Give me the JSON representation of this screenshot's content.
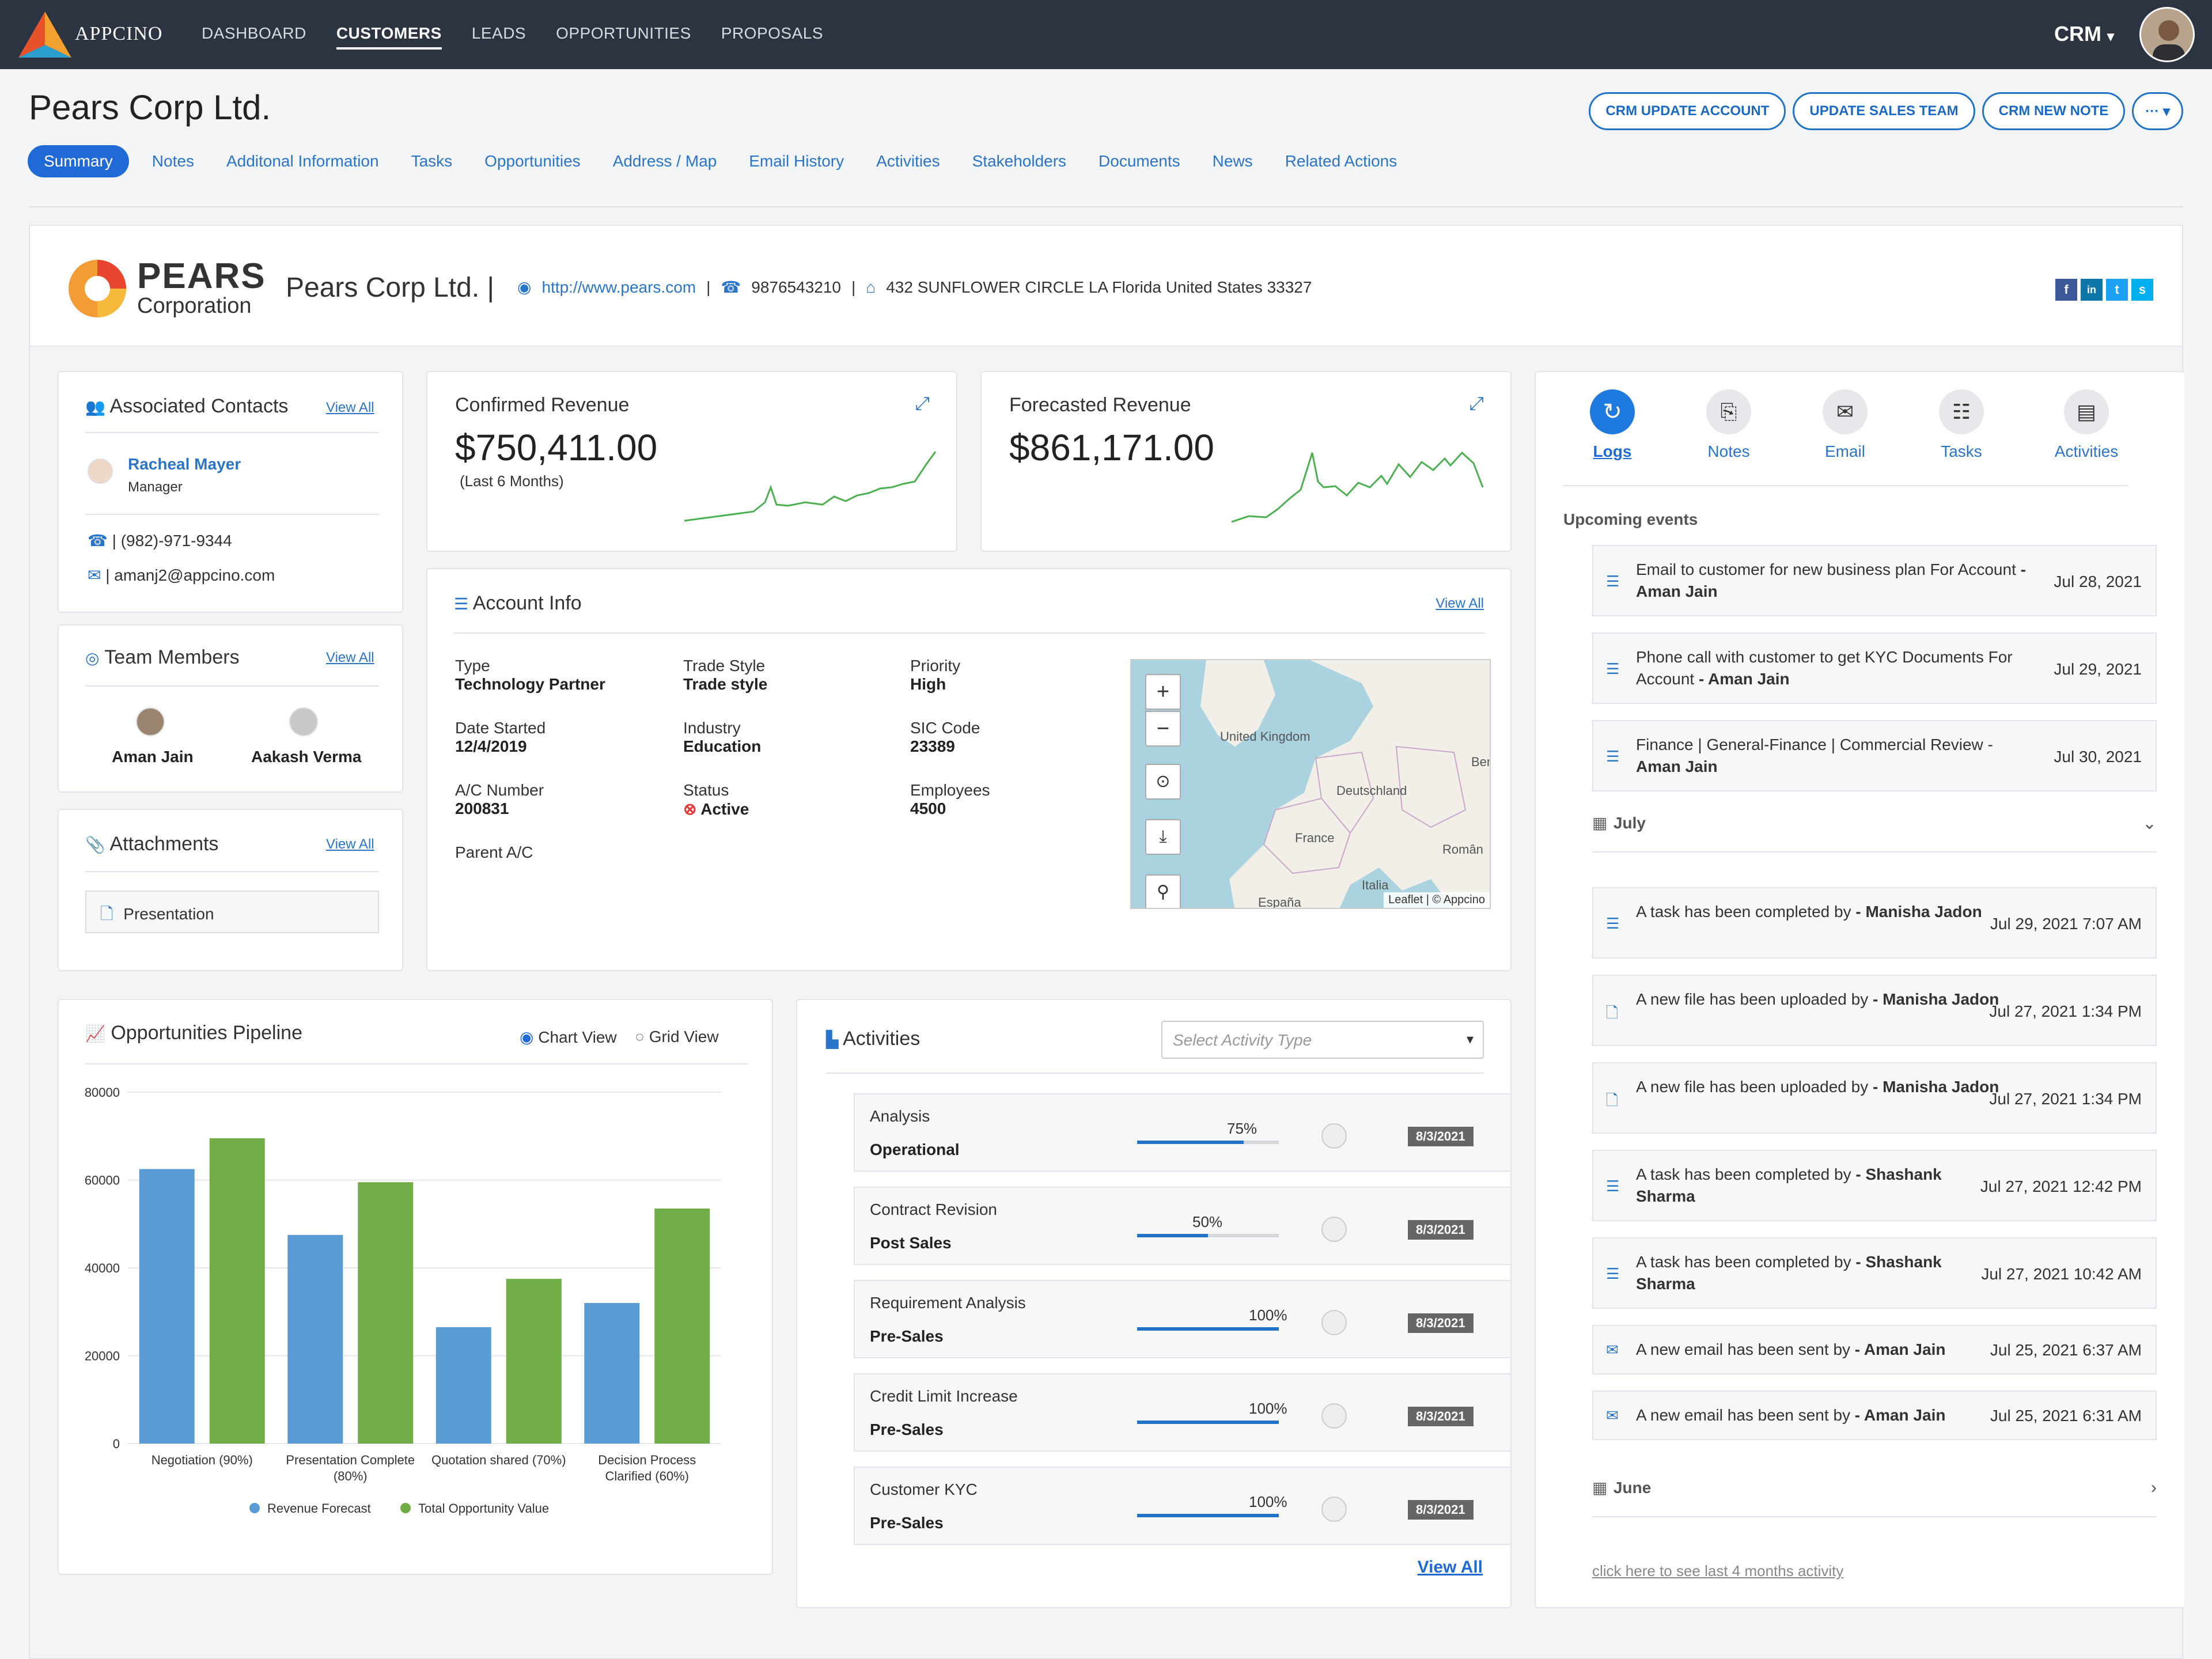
{
  "app": {
    "name": "APPCINO"
  },
  "nav": [
    "DASHBOARD",
    "CUSTOMERS",
    "LEADS",
    "OPPORTUNITIES",
    "PROPOSALS"
  ],
  "crm_menu": "CRM",
  "page_title": "Pears Corp Ltd.",
  "actions": [
    "CRM UPDATE ACCOUNT",
    "UPDATE SALES TEAM",
    "CRM NEW NOTE"
  ],
  "tabs": [
    "Summary",
    "Notes",
    "Additonal Information",
    "Tasks",
    "Opportunities",
    "Address / Map",
    "Email History",
    "Activities",
    "Stakeholders",
    "Documents",
    "News",
    "Related Actions"
  ],
  "company": {
    "logo_word": "PEARS",
    "logo_sub": "Corporation",
    "name": "Pears Corp Ltd.",
    "website": "http://www.pears.com",
    "phone": "9876543210",
    "address": "432 SUNFLOWER CIRCLE LA Florida United States 33327",
    "socials": [
      "f",
      "in",
      "t",
      "s"
    ]
  },
  "associated_contacts": {
    "title": "Associated Contacts",
    "view_all": "View All",
    "contact_name": "Racheal Mayer",
    "contact_role": "Manager",
    "phone": "| (982)-971-9344",
    "email": "| amanj2@appcino.com"
  },
  "team_members": {
    "title": "Team Members",
    "view_all": "View All",
    "members": [
      "Aman Jain",
      "Aakash Verma"
    ]
  },
  "attachments": {
    "title": "Attachments",
    "view_all": "View All",
    "file": "Presentation"
  },
  "confirmed_revenue": {
    "title": "Confirmed Revenue",
    "value": "$750,411.00",
    "note": "(Last 6 Months)"
  },
  "forecasted_revenue": {
    "title": "Forecasted Revenue",
    "value": "$861,171.00"
  },
  "account_info": {
    "title": "Account Info",
    "view_all": "View All",
    "fields": [
      {
        "label": "Type",
        "value": "Technology Partner"
      },
      {
        "label": "Trade Style",
        "value": "Trade style"
      },
      {
        "label": "Priority",
        "value": "High"
      },
      {
        "label": "Date Started",
        "value": "12/4/2019"
      },
      {
        "label": "Industry",
        "value": "Education"
      },
      {
        "label": "SIC Code",
        "value": "23389"
      },
      {
        "label": "A/C Number",
        "value": "200831"
      },
      {
        "label": "Status",
        "value": "Active"
      },
      {
        "label": "Employees",
        "value": "4500"
      },
      {
        "label": "Parent A/C",
        "value": ""
      }
    ],
    "map_labels": [
      "United Kingdom",
      "Deutschland",
      "France",
      "Ben",
      "Român",
      "Italia",
      "España"
    ],
    "map_attrib": "Leaflet | © Appcino"
  },
  "log_tabs": [
    "Logs",
    "Notes",
    "Email",
    "Tasks",
    "Activities"
  ],
  "upcoming": {
    "title": "Upcoming events",
    "items": [
      {
        "text": "Email to customer for new business plan For Account",
        "who": "- Aman Jain",
        "date": "Jul 28, 2021"
      },
      {
        "text": "Phone call with customer to get KYC Documents For Account",
        "who": "- Aman Jain",
        "date": "Jul 29, 2021"
      },
      {
        "text": "Finance  | General-Finance | Commercial Review -",
        "who": "Aman Jain",
        "date": "Jul 30, 2021"
      }
    ]
  },
  "month_july": "July",
  "month_june": "June",
  "history": [
    {
      "text": "A task has been completed by",
      "who": "- Manisha Jadon",
      "date": "Jul 29, 2021 7:07 AM",
      "icon": "list-icon"
    },
    {
      "text": "A new file has been uploaded by",
      "who": "- Manisha Jadon",
      "date": "Jul 27, 2021 1:34 PM",
      "icon": "file-icon"
    },
    {
      "text": "A new file has been uploaded by",
      "who": "- Manisha Jadon",
      "date": "Jul 27, 2021 1:34 PM",
      "icon": "file-icon"
    },
    {
      "text": "A task has been completed by",
      "who": "- Shashank Sharma",
      "date": "Jul 27, 2021 12:42 PM",
      "icon": "list-icon"
    },
    {
      "text": "A task has been completed by",
      "who": "- Shashank Sharma",
      "date": "Jul 27, 2021 10:42 AM",
      "icon": "list-icon"
    },
    {
      "text": "A new email has been sent by",
      "who": "- Aman Jain",
      "date": "Jul 25, 2021 6:37 AM",
      "icon": "mail-icon"
    },
    {
      "text": "A new email has been sent by",
      "who": "- Aman Jain",
      "date": "Jul 25, 2021 6:31 AM",
      "icon": "mail-icon"
    }
  ],
  "last_months_link": "click here to see last 4 months activity",
  "pipeline": {
    "title": "Opportunities Pipeline",
    "views": [
      "Chart View",
      "Grid View"
    ]
  },
  "chart_data": {
    "type": "bar",
    "categories": [
      "Negotiation (90%)",
      "Presentation Complete (80%)",
      "Quotation shared (70%)",
      "Decision Process Clarified (60%)"
    ],
    "series": [
      {
        "name": "Revenue Forecast",
        "values": [
          62500,
          47500,
          26500,
          32000
        ],
        "color": "#5b9bd5"
      },
      {
        "name": "Total Opportunity Value",
        "values": [
          69500,
          59500,
          37500,
          53500
        ],
        "color": "#70ad47"
      }
    ],
    "ylim": [
      0,
      80000
    ],
    "yticks": [
      0,
      20000,
      40000,
      60000,
      80000
    ],
    "legend": "bottom"
  },
  "activities": {
    "title": "Activities",
    "select_placeholder": "Select Activity Type",
    "view_all": "View All",
    "rows": [
      {
        "name": "Analysis",
        "stage": "Operational",
        "pct": "75%",
        "progress": 75,
        "date": "8/3/2021"
      },
      {
        "name": "Contract Revision",
        "stage": "Post Sales",
        "pct": "50%",
        "progress": 50,
        "date": "8/3/2021"
      },
      {
        "name": "Requirement Analysis",
        "stage": "Pre-Sales",
        "pct": "100%",
        "progress": 100,
        "date": "8/3/2021"
      },
      {
        "name": "Credit Limit Increase",
        "stage": "Pre-Sales",
        "pct": "100%",
        "progress": 100,
        "date": "8/3/2021"
      },
      {
        "name": "Customer KYC",
        "stage": "Pre-Sales",
        "pct": "100%",
        "progress": 100,
        "date": "8/3/2021"
      }
    ]
  }
}
